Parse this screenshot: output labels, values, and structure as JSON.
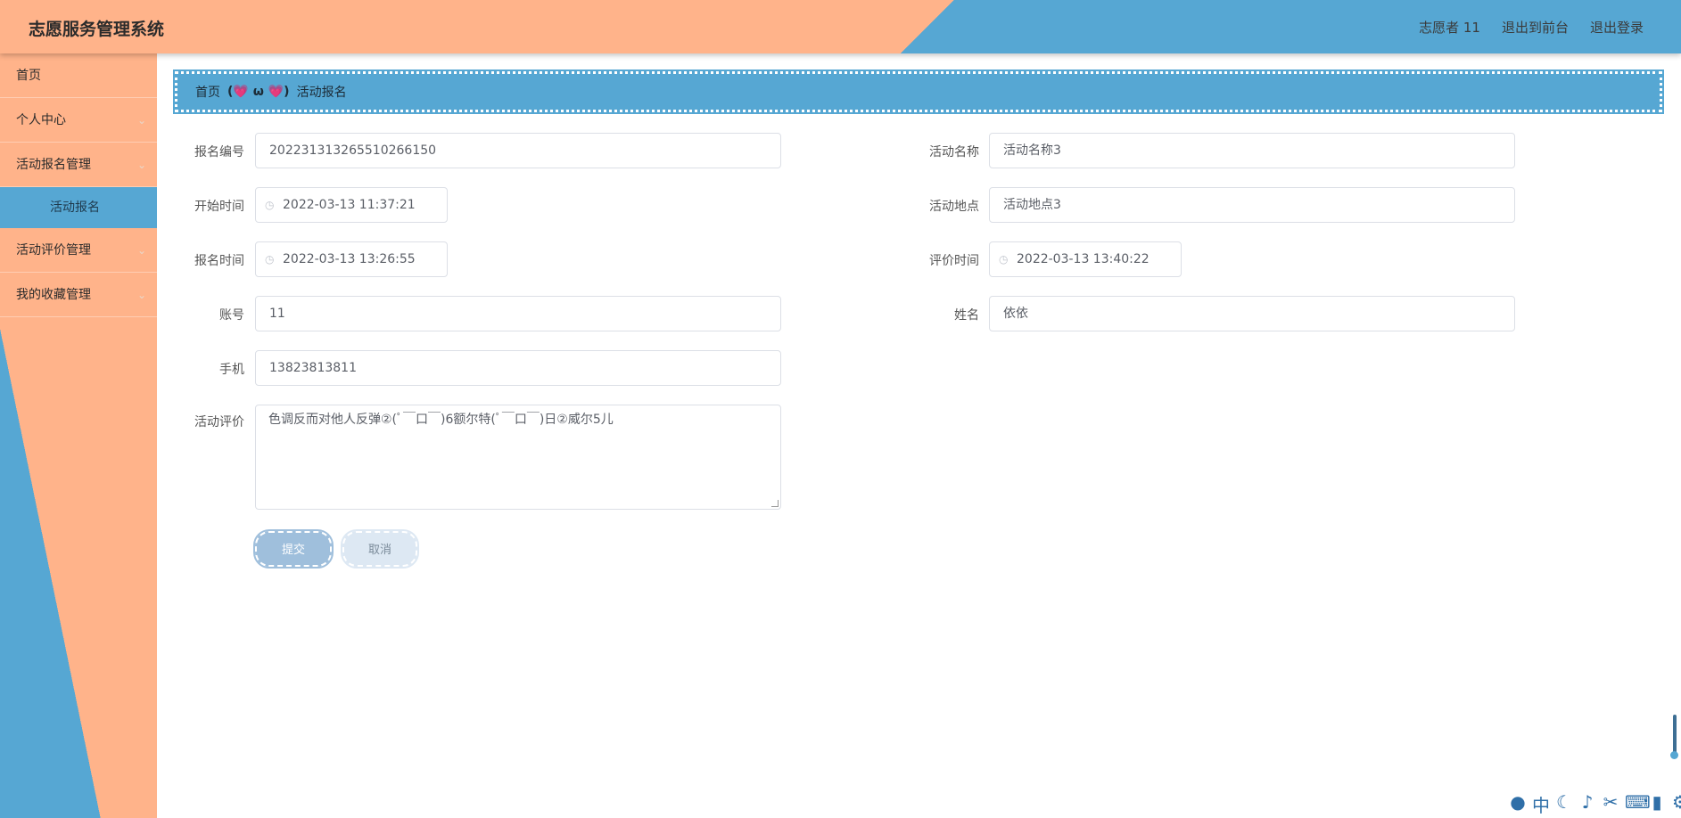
{
  "header": {
    "title": "志愿服务管理系统",
    "user": "志愿者 11",
    "back_front": "退出到前台",
    "logout": "退出登录"
  },
  "sidebar": {
    "items": [
      {
        "label": "首页"
      },
      {
        "label": "个人中心"
      },
      {
        "label": "活动报名管理"
      },
      {
        "label": "活动报名"
      },
      {
        "label": "活动评价管理"
      },
      {
        "label": "我的收藏管理"
      }
    ]
  },
  "breadcrumb": {
    "home": "首页",
    "separator": "(💗 ω 💗)",
    "current": "活动报名"
  },
  "form": {
    "signup_no": {
      "label": "报名编号",
      "value": "202231313265510266150"
    },
    "activity_name": {
      "label": "活动名称",
      "value": "活动名称3"
    },
    "start_time": {
      "label": "开始时间",
      "value": "2022-03-13 11:37:21"
    },
    "activity_location": {
      "label": "活动地点",
      "value": "活动地点3"
    },
    "signup_time": {
      "label": "报名时间",
      "value": "2022-03-13 13:26:55"
    },
    "review_time": {
      "label": "评价时间",
      "value": "2022-03-13 13:40:22"
    },
    "account": {
      "label": "账号",
      "value": "11"
    },
    "name": {
      "label": "姓名",
      "value": "依依"
    },
    "phone": {
      "label": "手机",
      "value": "13823813811"
    },
    "review": {
      "label": "活动评价",
      "value": "色调反而对他人反弹②(ﾟ￣口￣)6额尔特(ﾟ￣口￣)日②威尔5儿"
    },
    "submit": "提交",
    "cancel": "取消"
  },
  "colors": {
    "peach": "#ffb38a",
    "blue": "#56a7d3",
    "submit_bg": "#9fbfdc",
    "cancel_bg": "#dde8f3"
  }
}
